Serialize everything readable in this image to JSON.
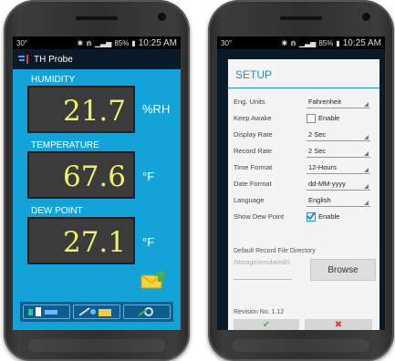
{
  "status": {
    "left": {
      "temp": "30°",
      "battery": "85%",
      "time": "10:25 AM"
    },
    "right": {
      "temp": "30°",
      "battery": "85%",
      "time": "10:25 AM"
    }
  },
  "left_app": {
    "title": "TH Probe",
    "humidity": {
      "label": "HUMIDITY",
      "value": "21.7",
      "unit": "%RH"
    },
    "temperature": {
      "label": "TEMPERATURE",
      "value": "67.6",
      "unit": "°F"
    },
    "dew_point": {
      "label": "DEW POINT",
      "value": "27.1",
      "unit": "°F"
    },
    "accent": "#14a3d9",
    "value_color": "#f2f06a"
  },
  "setup": {
    "title": "SETUP",
    "rows": [
      {
        "label": "Eng. Units",
        "value": "Fahrenheit"
      },
      {
        "label": "Keep Awake",
        "check": "Enable"
      },
      {
        "label": "Display Rate",
        "value": "2 Sec"
      },
      {
        "label": "Record Rate",
        "value": "2 Sec"
      },
      {
        "label": "Time Format",
        "value": "12-Hours"
      },
      {
        "label": "Date Format",
        "value": "dd-MM-yyyy"
      },
      {
        "label": "Language",
        "value": "English"
      },
      {
        "label": "Show Dew Point",
        "check": "Enable"
      }
    ],
    "dir_label": "Default Record File Directory",
    "dir_value": "/storage/emulated/0",
    "browse": "Browse",
    "revision": "Revision No.   1.12",
    "ok": "✔",
    "cancel": "✖",
    "accent": "#1a8fd0"
  }
}
